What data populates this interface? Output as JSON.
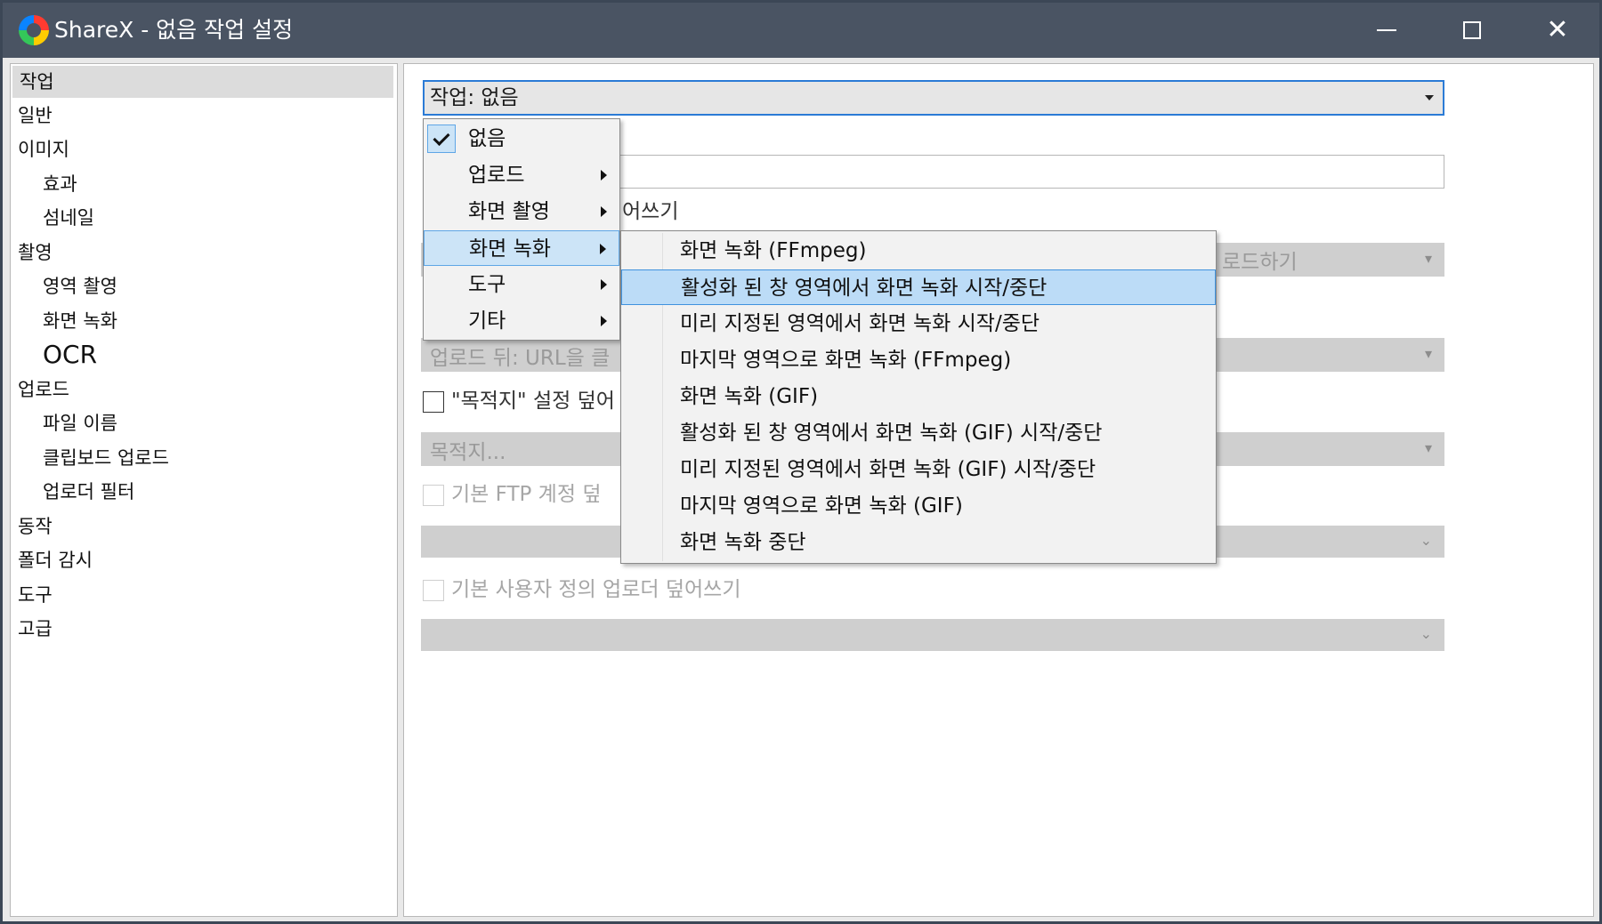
{
  "window": {
    "title": "ShareX - 없음 작업 설정"
  },
  "titlebar": {
    "icons": [
      "sharex-logo-icon",
      "minimize-icon",
      "maximize-icon",
      "close-icon"
    ]
  },
  "sidebar": {
    "items": [
      {
        "label": "작업",
        "selected": true
      },
      {
        "label": "일반"
      },
      {
        "label": "이미지"
      },
      {
        "label": "효과"
      },
      {
        "label": "섬네일"
      },
      {
        "label": "촬영"
      },
      {
        "label": "영역 촬영"
      },
      {
        "label": "화면 녹화"
      },
      {
        "label": "OCR"
      },
      {
        "label": "업로드"
      },
      {
        "label": "파일 이름"
      },
      {
        "label": "클립보드 업로드"
      },
      {
        "label": "업로더 필터"
      },
      {
        "label": "동작"
      },
      {
        "label": "폴더 감시"
      },
      {
        "label": "도구"
      },
      {
        "label": "고급"
      }
    ]
  },
  "main": {
    "task_combo": "작업: 없음",
    "fragment_overwrite": "어쓰기",
    "fragment_upload": "로드하기",
    "after_upload_bar": "업로드 뒤: URL을 클",
    "destination_check_label": "\"목적지\" 설정 덮어",
    "destination_placeholder": "목적지...",
    "ftp_check_label": "기본 FTP 계정 덮",
    "custom_uploader_label": "기본 사용자 정의 업로더 덮어쓰기"
  },
  "menu1": {
    "items": [
      {
        "label": "없음",
        "checked": true
      },
      {
        "label": "업로드",
        "submenu": true
      },
      {
        "label": "화면 촬영",
        "submenu": true
      },
      {
        "label": "화면 녹화",
        "submenu": true,
        "open": true
      },
      {
        "label": "도구",
        "submenu": true
      },
      {
        "label": "기타",
        "submenu": true
      }
    ]
  },
  "menu2": {
    "items": [
      {
        "label": "화면 녹화 (FFmpeg)"
      },
      {
        "label": "활성화 된 창 영역에서 화면 녹화 시작/중단",
        "highlighted": true
      },
      {
        "label": "미리 지정된 영역에서 화면 녹화 시작/중단"
      },
      {
        "label": "마지막 영역으로 화면 녹화 (FFmpeg)"
      },
      {
        "label": "화면 녹화 (GIF)"
      },
      {
        "label": "활성화 된 창 영역에서 화면 녹화 (GIF) 시작/중단"
      },
      {
        "label": "미리 지정된 영역에서 화면 녹화 (GIF) 시작/중단"
      },
      {
        "label": "마지막 영역으로 화면 녹화 (GIF)"
      },
      {
        "label": "화면 녹화 중단"
      }
    ]
  },
  "colors": {
    "titlebar": "#4a5463",
    "accent": "#2b7bd6",
    "menu_highlight": "#bcdcf7"
  }
}
